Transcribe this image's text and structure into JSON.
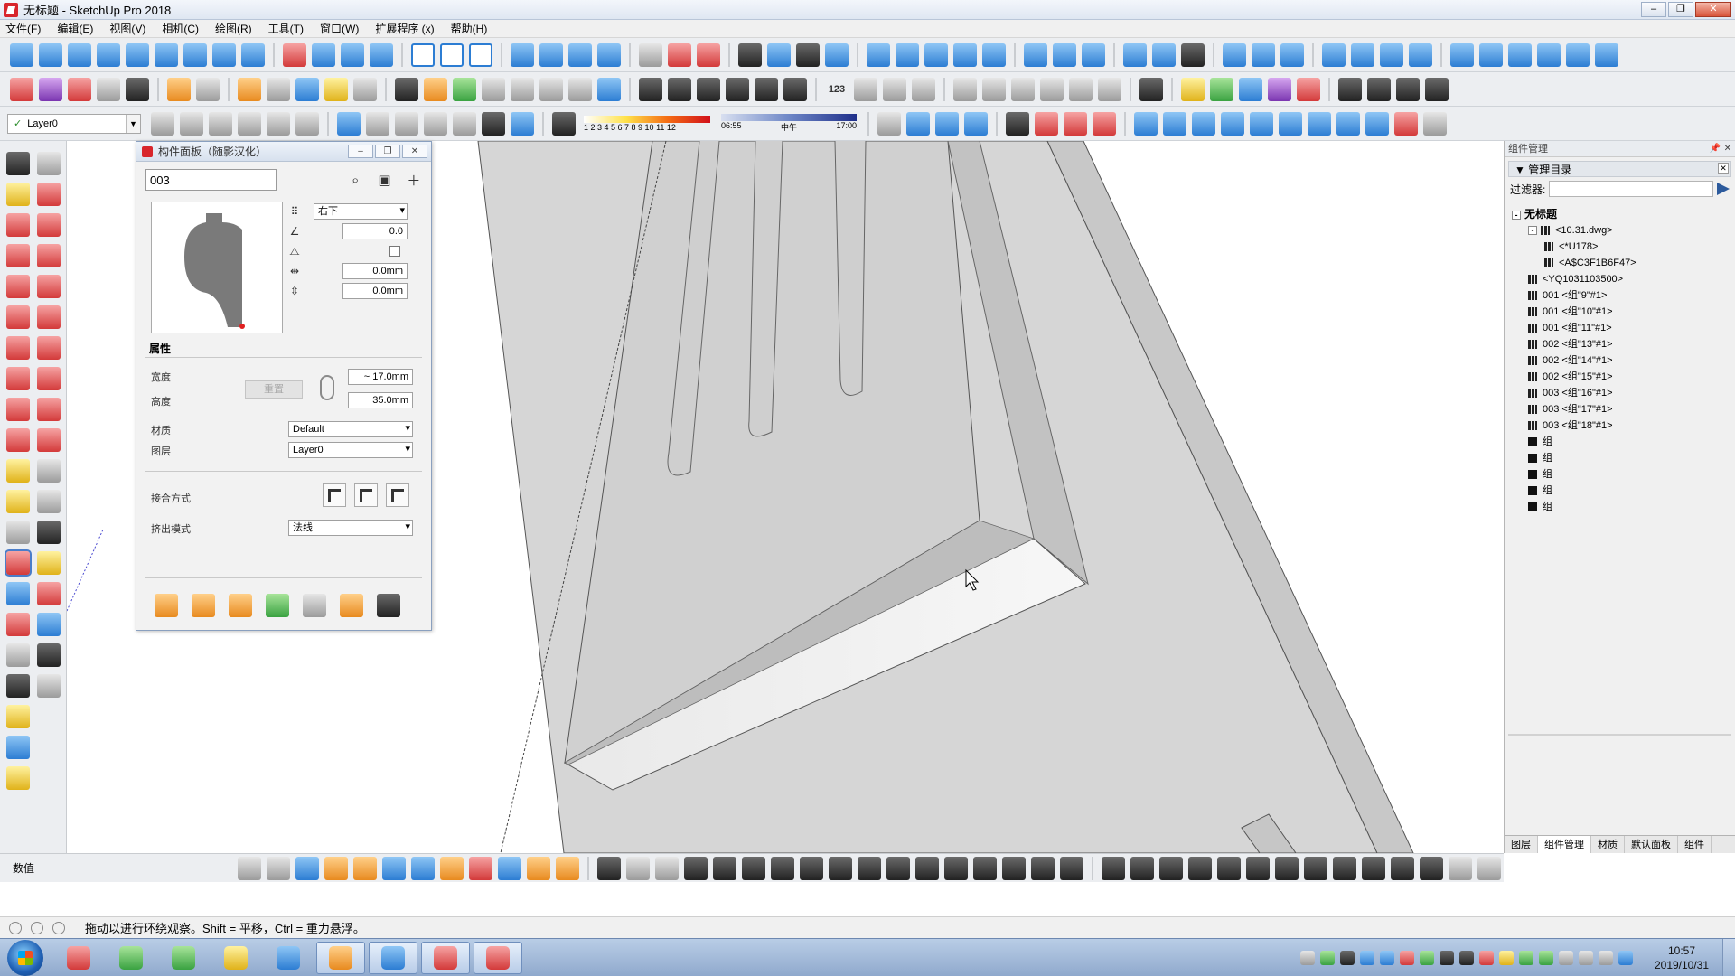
{
  "window": {
    "title": "无标题 - SketchUp Pro 2018"
  },
  "menu": [
    "文件(F)",
    "编辑(E)",
    "视图(V)",
    "相机(C)",
    "绘图(R)",
    "工具(T)",
    "窗口(W)",
    "扩展程序 (x)",
    "帮助(H)"
  ],
  "toolbar": {
    "layer_value": "Layer0",
    "shadow_numbers": "1 2 3 4 5 6 7 8 9 10 11 12",
    "time_start": "06:55",
    "time_mid": "中午",
    "time_end": "17:00",
    "number_badge": "123"
  },
  "component_panel": {
    "title": "构件面板（随影汉化）",
    "search_value": "003",
    "placement": "右下",
    "angle": "0.0",
    "offset_x": "0.0mm",
    "offset_y": "0.0mm",
    "properties_title": "属性",
    "width_label": "宽度",
    "width_value": "~ 17.0mm",
    "height_label": "高度",
    "height_value": "35.0mm",
    "reset_label": "重置",
    "material_label": "材质",
    "material_value": "Default",
    "layer_label": "图层",
    "layer_value": "Layer0",
    "joint_label": "接合方式",
    "extrude_label": "挤出模式",
    "extrude_value": "法线"
  },
  "component_manager": {
    "title": "组件管理",
    "section": "管理目录",
    "filter_label": "过滤器:",
    "tree": [
      {
        "label": "无标题",
        "level": 0,
        "root": true
      },
      {
        "label": "<10.31.dwg>",
        "level": 1,
        "expand": "-"
      },
      {
        "label": "<*U178>",
        "level": 2
      },
      {
        "label": "<A$C3F1B6F47>",
        "level": 2
      },
      {
        "label": "<YQ1031103500>",
        "level": 1
      },
      {
        "label": "001 <组\"9\"#1>",
        "level": 1
      },
      {
        "label": "001 <组\"10\"#1>",
        "level": 1
      },
      {
        "label": "001 <组\"11\"#1>",
        "level": 1
      },
      {
        "label": "002 <组\"13\"#1>",
        "level": 1
      },
      {
        "label": "002 <组\"14\"#1>",
        "level": 1
      },
      {
        "label": "002 <组\"15\"#1>",
        "level": 1
      },
      {
        "label": "003 <组\"16\"#1>",
        "level": 1
      },
      {
        "label": "003 <组\"17\"#1>",
        "level": 1
      },
      {
        "label": "003 <组\"18\"#1>",
        "level": 1
      },
      {
        "label": "组",
        "level": 1,
        "solid": true
      },
      {
        "label": "组",
        "level": 1,
        "solid": true
      },
      {
        "label": "组",
        "level": 1,
        "solid": true
      },
      {
        "label": "组",
        "level": 1,
        "solid": true
      },
      {
        "label": "组",
        "level": 1,
        "solid": true
      }
    ],
    "tabs": [
      "图层",
      "组件管理",
      "材质",
      "默认面板",
      "组件"
    ]
  },
  "measurements": {
    "label": "数值"
  },
  "status": {
    "message": "拖动以进行环绕观察。Shift = 平移，Ctrl = 重力悬浮。"
  },
  "taskbar": {
    "time": "10:57",
    "date": "2019/10/31"
  }
}
